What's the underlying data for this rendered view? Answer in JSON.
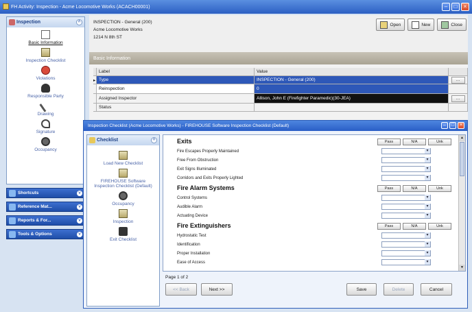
{
  "window": {
    "title": "FH Activity: Inspection - Acme Locomotive Works (ACACH00001)"
  },
  "sidebar": {
    "panel_title": "Inspection",
    "items": [
      {
        "label": "Basic Information",
        "icon": "document-icon",
        "active": true
      },
      {
        "label": "Inspection Checklist",
        "icon": "checklist-icon"
      },
      {
        "label": "Violations",
        "icon": "violation-icon"
      },
      {
        "label": "Responsible Party",
        "icon": "person-icon"
      },
      {
        "label": "Drawing",
        "icon": "pencil-icon"
      },
      {
        "label": "Signature",
        "icon": "signature-icon"
      },
      {
        "label": "Occupancy",
        "icon": "occupancy-icon"
      }
    ],
    "groups": [
      "Shortcuts",
      "Reference Mat...",
      "Reports & For...",
      "Tools & Options"
    ]
  },
  "header": {
    "line1": "INSPECTION - General (200)",
    "line2": "Acme Locomotive Works",
    "line3": "1214 N 8th ST",
    "buttons": {
      "open": "Open",
      "new": "New",
      "close": "Close"
    }
  },
  "section": {
    "title": "Basic Information"
  },
  "grid": {
    "columns": [
      "Label",
      "Value"
    ],
    "rows": [
      {
        "label": "Type",
        "value": "INSPECTION - General (200)"
      },
      {
        "label": "Reinspection",
        "value": "0"
      },
      {
        "label": "Assigned Inspector",
        "value": "Allison, John E (Firefighter Paramedic)(30-JEA)"
      },
      {
        "label": "Status",
        "value": ""
      }
    ]
  },
  "dialog": {
    "title": "Inspection Checklist (Acme Locomotive Works) - FIREHOUSE Software Inspection Checklist (Default)",
    "side_panel_title": "Checklist",
    "side_items": [
      {
        "label": "Load New Checklist",
        "icon": "checklist-icon"
      },
      {
        "label": "FIREHOUSE Software Inspection Checklist (Default)",
        "icon": "checklist-icon"
      },
      {
        "label": "Occupancy",
        "icon": "occupancy-icon"
      },
      {
        "label": "Inspection",
        "icon": "document-icon"
      },
      {
        "label": "Exit Checklist",
        "icon": "exit-icon"
      }
    ],
    "section_buttons": {
      "pass": "Pass",
      "na": "N/A",
      "unk": "Unk"
    },
    "sections": [
      {
        "title": "Exits",
        "items": [
          "Fire Escapes Properly Maintained",
          "Free From Obstruction",
          "Exit Signs Illuminated",
          "Corridors and Exits Properly Lighted"
        ]
      },
      {
        "title": "Fire Alarm Systems",
        "items": [
          "Control Systems",
          "Audible Alarm",
          "Actuating Device"
        ]
      },
      {
        "title": "Fire Extinguishers",
        "items": [
          "Hydrostatic Test",
          "Identification",
          "Proper Installation",
          "Ease of Access"
        ]
      }
    ],
    "page_indicator": "Page 1 of 2",
    "buttons": {
      "back": "<< Back",
      "next": "Next >>",
      "save": "Save",
      "delete": "Delete",
      "cancel": "Cancel"
    }
  }
}
